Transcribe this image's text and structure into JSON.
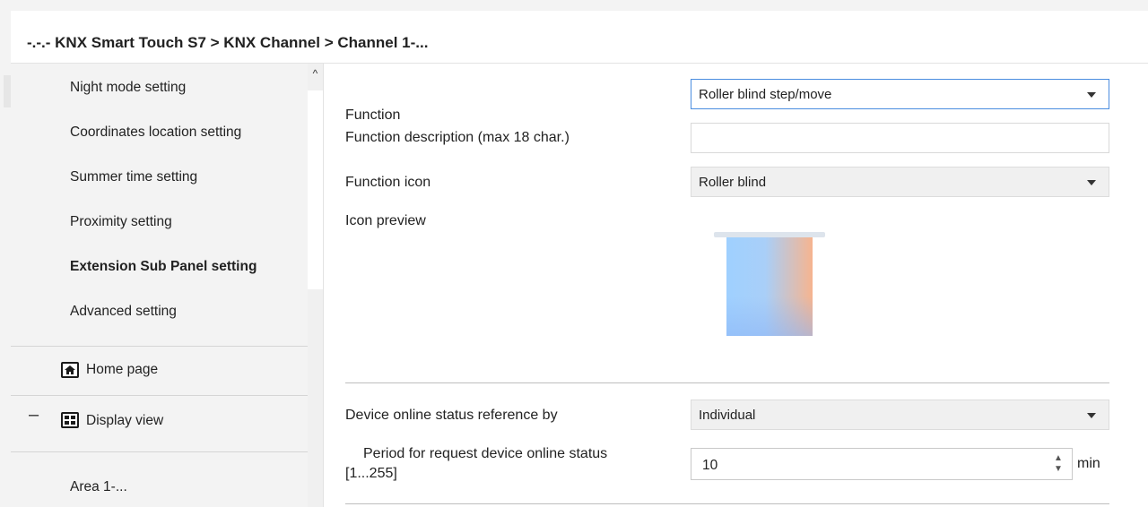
{
  "breadcrumb": "-.-.- KNX Smart Touch S7 > KNX Channel  > Channel 1-...",
  "sidebar": {
    "items": [
      {
        "label": "Night mode setting",
        "bold": false
      },
      {
        "label": "Coordinates location setting",
        "bold": false
      },
      {
        "label": "Summer time setting",
        "bold": false
      },
      {
        "label": "Proximity setting",
        "bold": false
      },
      {
        "label": "Extension Sub Panel setting",
        "bold": true
      },
      {
        "label": "Advanced setting",
        "bold": false
      }
    ],
    "home_label": "Home page",
    "home_icon": "home-icon",
    "display_collapse": "–",
    "display_label": "Display view",
    "display_icon": "grid-icon",
    "area_label": "Area 1-..."
  },
  "scrollbar": {
    "up_glyph": "^"
  },
  "form": {
    "function": {
      "label": "Function",
      "value": "Roller blind step/move"
    },
    "description": {
      "label": "Function description (max 18 char.)",
      "value": ""
    },
    "icon": {
      "label": "Function icon",
      "value": "Roller blind"
    },
    "preview": {
      "label": "Icon preview"
    },
    "online_ref": {
      "label": "Device online status reference by",
      "value": "Individual"
    },
    "period": {
      "label_line1": "Period for request device online status",
      "label_line2": "[1...255]",
      "value": "10",
      "unit": "min"
    }
  },
  "colors": {
    "accent_border": "#4a8de0",
    "sidebar_bg": "#f3f3f3"
  }
}
